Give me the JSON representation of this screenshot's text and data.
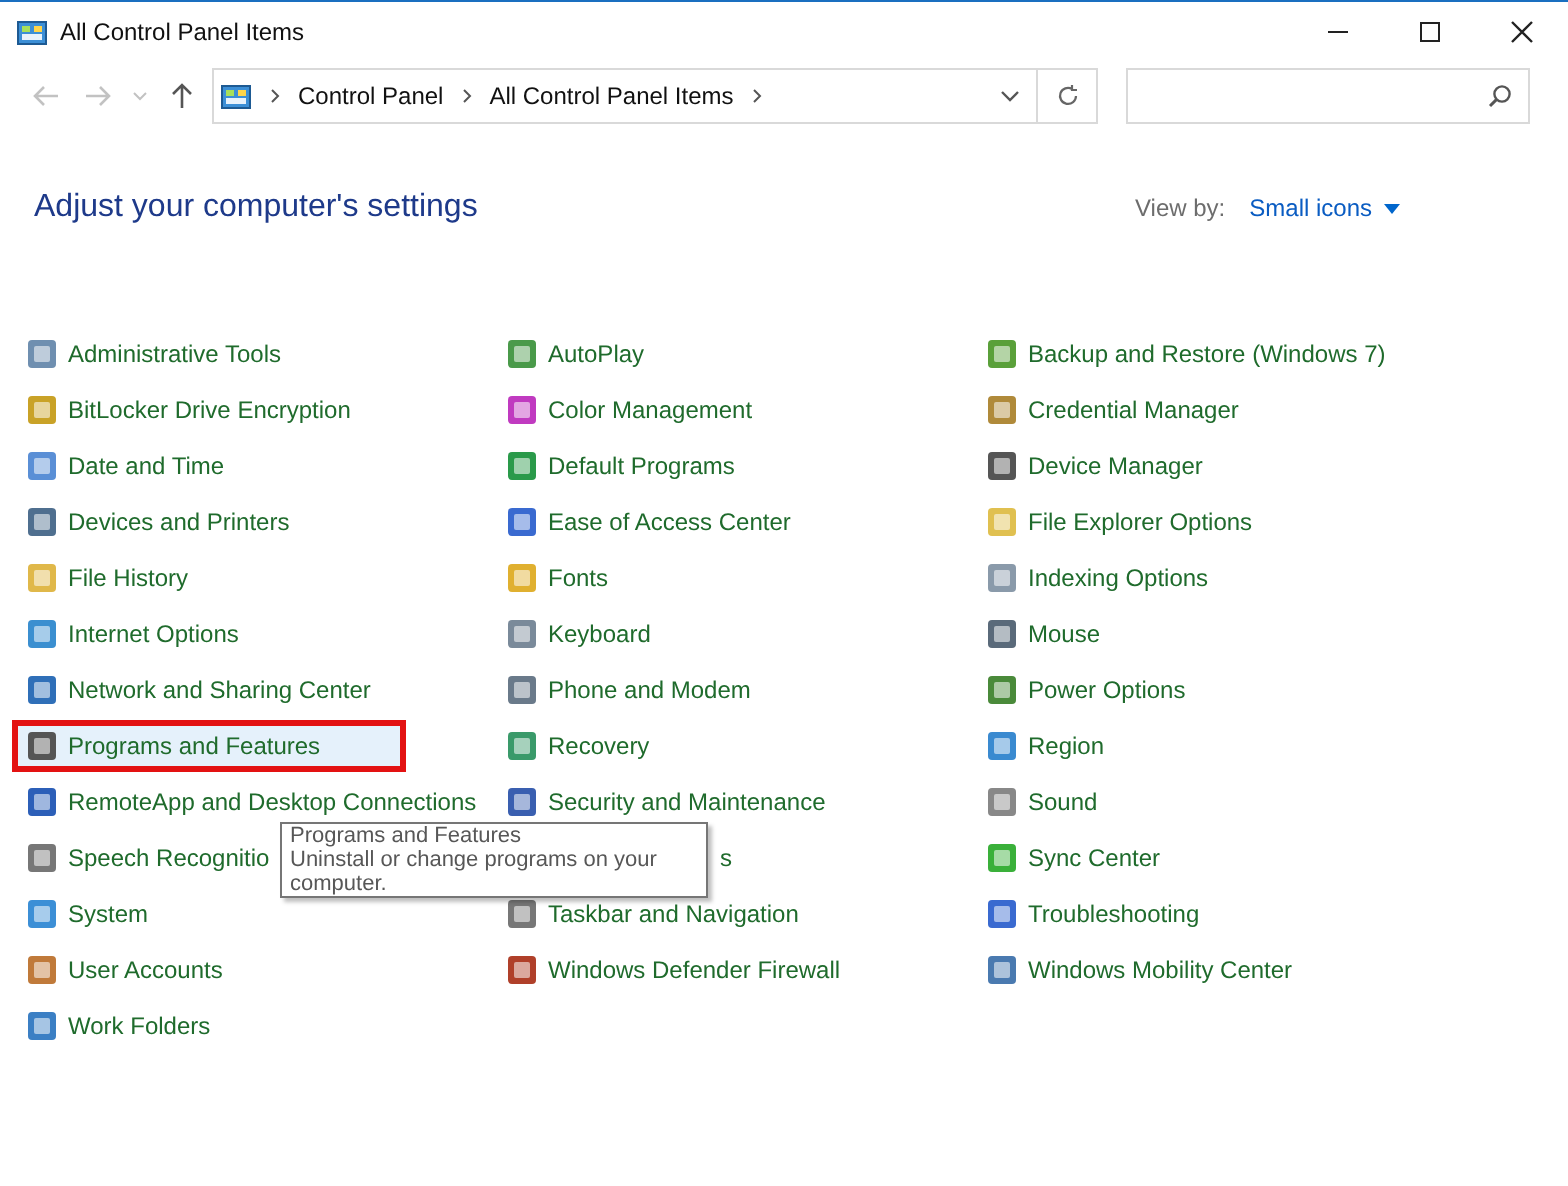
{
  "window": {
    "title": "All Control Panel Items"
  },
  "address_bar": {
    "breadcrumbs": [
      "Control Panel",
      "All Control Panel Items"
    ]
  },
  "heading": "Adjust your computer's settings",
  "view_by": {
    "label": "View by:",
    "value": "Small icons"
  },
  "columns": [
    [
      {
        "label": "Administrative Tools",
        "hovered": false,
        "highlighted": false,
        "kind": "item"
      },
      {
        "label": "BitLocker Drive Encryption",
        "hovered": false,
        "highlighted": false,
        "kind": "item"
      },
      {
        "label": "Date and Time",
        "hovered": false,
        "highlighted": false,
        "kind": "item"
      },
      {
        "label": "Devices and Printers",
        "hovered": false,
        "highlighted": false,
        "kind": "item"
      },
      {
        "label": "File History",
        "hovered": false,
        "highlighted": false,
        "kind": "item"
      },
      {
        "label": "Internet Options",
        "hovered": false,
        "highlighted": false,
        "kind": "item"
      },
      {
        "label": "Network and Sharing Center",
        "hovered": false,
        "highlighted": false,
        "kind": "item"
      },
      {
        "label": "Programs and Features",
        "hovered": true,
        "highlighted": true,
        "kind": "item"
      },
      {
        "label": "RemoteApp and Desktop Connections",
        "hovered": false,
        "highlighted": false,
        "kind": "item"
      },
      {
        "label": "Speech Recognitio",
        "hovered": false,
        "highlighted": false,
        "kind": "item"
      },
      {
        "label": "System",
        "hovered": false,
        "highlighted": false,
        "kind": "item"
      },
      {
        "label": "User Accounts",
        "hovered": false,
        "highlighted": false,
        "kind": "item"
      },
      {
        "label": "Work Folders",
        "hovered": false,
        "highlighted": false,
        "kind": "item"
      }
    ],
    [
      {
        "label": "AutoPlay",
        "hovered": false,
        "highlighted": false,
        "kind": "item"
      },
      {
        "label": "Color Management",
        "hovered": false,
        "highlighted": false,
        "kind": "item"
      },
      {
        "label": "Default Programs",
        "hovered": false,
        "highlighted": false,
        "kind": "item"
      },
      {
        "label": "Ease of Access Center",
        "hovered": false,
        "highlighted": false,
        "kind": "item"
      },
      {
        "label": "Fonts",
        "hovered": false,
        "highlighted": false,
        "kind": "item"
      },
      {
        "label": "Keyboard",
        "hovered": false,
        "highlighted": false,
        "kind": "item"
      },
      {
        "label": "Phone and Modem",
        "hovered": false,
        "highlighted": false,
        "kind": "item"
      },
      {
        "label": "Recovery",
        "hovered": false,
        "highlighted": false,
        "kind": "item"
      },
      {
        "label": "Security and Maintenance",
        "hovered": false,
        "highlighted": false,
        "kind": "item"
      },
      {
        "label": "s",
        "hovered": false,
        "highlighted": false,
        "kind": "covered"
      },
      {
        "label": "Taskbar and Navigation",
        "hovered": false,
        "highlighted": false,
        "kind": "item"
      },
      {
        "label": "Windows Defender Firewall",
        "hovered": false,
        "highlighted": false,
        "kind": "item"
      }
    ],
    [
      {
        "label": "Backup and Restore (Windows 7)",
        "hovered": false,
        "highlighted": false,
        "kind": "item"
      },
      {
        "label": "Credential Manager",
        "hovered": false,
        "highlighted": false,
        "kind": "item"
      },
      {
        "label": "Device Manager",
        "hovered": false,
        "highlighted": false,
        "kind": "item"
      },
      {
        "label": "File Explorer Options",
        "hovered": false,
        "highlighted": false,
        "kind": "item"
      },
      {
        "label": "Indexing Options",
        "hovered": false,
        "highlighted": false,
        "kind": "item"
      },
      {
        "label": "Mouse",
        "hovered": false,
        "highlighted": false,
        "kind": "item"
      },
      {
        "label": "Power Options",
        "hovered": false,
        "highlighted": false,
        "kind": "item"
      },
      {
        "label": "Region",
        "hovered": false,
        "highlighted": false,
        "kind": "item"
      },
      {
        "label": "Sound",
        "hovered": false,
        "highlighted": false,
        "kind": "item"
      },
      {
        "label": "Sync Center",
        "hovered": false,
        "highlighted": false,
        "kind": "item"
      },
      {
        "label": "Troubleshooting",
        "hovered": false,
        "highlighted": false,
        "kind": "item"
      },
      {
        "label": "Windows Mobility Center",
        "hovered": false,
        "highlighted": false,
        "kind": "item"
      }
    ]
  ],
  "tooltip": {
    "title": "Programs and Features",
    "description": "Uninstall or change programs on your computer."
  }
}
